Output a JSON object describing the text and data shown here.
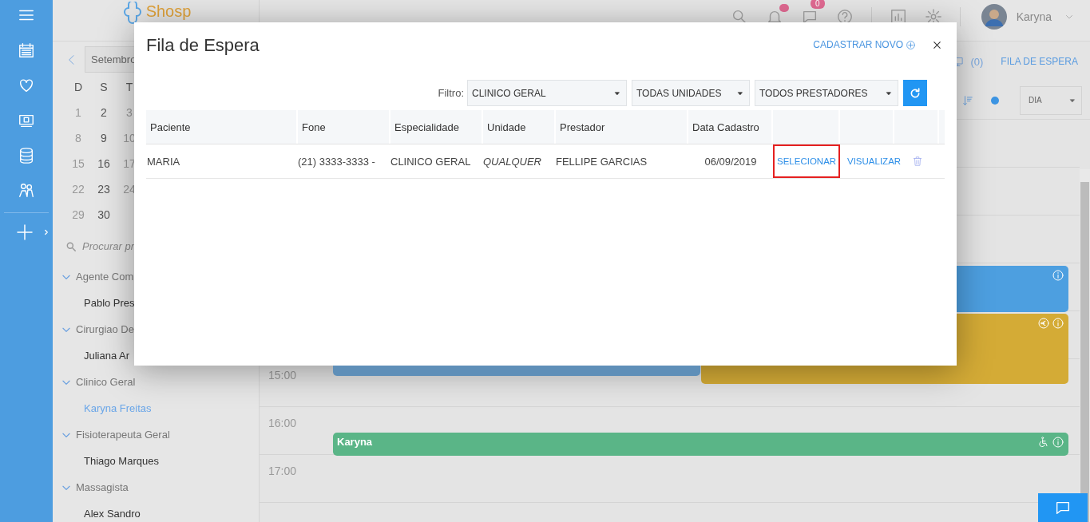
{
  "header": {
    "logo": "Shosp",
    "badges": [
      {
        "kind": "dot"
      },
      {
        "kind": "count",
        "count": "0"
      }
    ],
    "user": "Karyna"
  },
  "sidebar": {
    "month": "Setembro",
    "weekdays": [
      "D",
      "S",
      "T"
    ],
    "weeks": [
      [
        {
          "day": "1",
          "muted": true
        },
        {
          "day": "2",
          "muted": false
        },
        {
          "day": "3",
          "muted": true
        }
      ],
      [
        {
          "day": "8",
          "muted": true
        },
        {
          "day": "9",
          "muted": false
        },
        {
          "day": "10",
          "muted": true
        }
      ],
      [
        {
          "day": "15",
          "muted": true
        },
        {
          "day": "16",
          "muted": false
        },
        {
          "day": "17",
          "muted": true
        }
      ],
      [
        {
          "day": "22",
          "muted": true
        },
        {
          "day": "23",
          "muted": false
        },
        {
          "day": "24",
          "muted": true
        }
      ],
      [
        {
          "day": "29",
          "muted": true
        },
        {
          "day": "30",
          "muted": false
        }
      ]
    ],
    "search_placeholder": "Procurar pr",
    "groups": [
      {
        "label": "Agente Com",
        "expanded": true,
        "children": [
          {
            "label": "Pablo Pres",
            "selected": false
          }
        ]
      },
      {
        "label": "Cirurgiao De",
        "expanded": true,
        "children": [
          {
            "label": "Juliana Ar",
            "selected": false
          }
        ]
      },
      {
        "label": "Clinico Geral",
        "expanded": true,
        "children": [
          {
            "label": "Karyna Freitas",
            "selected": true
          }
        ]
      },
      {
        "label": "Fisioterapeuta Geral",
        "expanded": true,
        "children": [
          {
            "label": "Thiago Marques",
            "selected": false
          }
        ]
      },
      {
        "label": "Massagista",
        "expanded": true,
        "children": [
          {
            "label": "Alex Sandro",
            "selected": false
          }
        ]
      }
    ]
  },
  "toolbar": {
    "count": "(0)",
    "queue_link": "FILA DE ESPERA",
    "view": "DIA"
  },
  "calendar": {
    "rows": [
      {},
      {},
      {},
      {},
      {},
      {
        "time": "15:00"
      },
      {
        "time": "16:00"
      },
      {
        "time": "17:00"
      }
    ],
    "events": [
      {
        "kind": "info",
        "color": "#4d9fe0"
      },
      {
        "kind": "payment",
        "color": "#d4ab36"
      },
      {
        "kind": "plain",
        "color": "#5f8fb8"
      },
      {
        "kind": "accessible",
        "color": "#5ab587",
        "label": "Karyna"
      }
    ]
  },
  "modal": {
    "title": "Fila de Espera",
    "new_link": "CADASTRAR NOVO",
    "filter_label": "Filtro:",
    "filters": [
      "CLINICO GERAL",
      "TODAS UNIDADES",
      "TODOS PRESTADORES"
    ],
    "columns": [
      "Paciente",
      "Fone",
      "Especialidade",
      "Unidade",
      "Prestador",
      "Data Cadastro"
    ],
    "rows": [
      {
        "cells": [
          "MARIA",
          "(21) 3333-3333 -",
          "CLINICO GERAL",
          "QUALQUER",
          "FELLIPE GARCIAS",
          "06/09/2019"
        ],
        "actions": [
          {
            "label": "SELECIONAR",
            "highlighted": true
          },
          {
            "label": "VISUALIZAR",
            "highlighted": false
          }
        ]
      }
    ]
  }
}
